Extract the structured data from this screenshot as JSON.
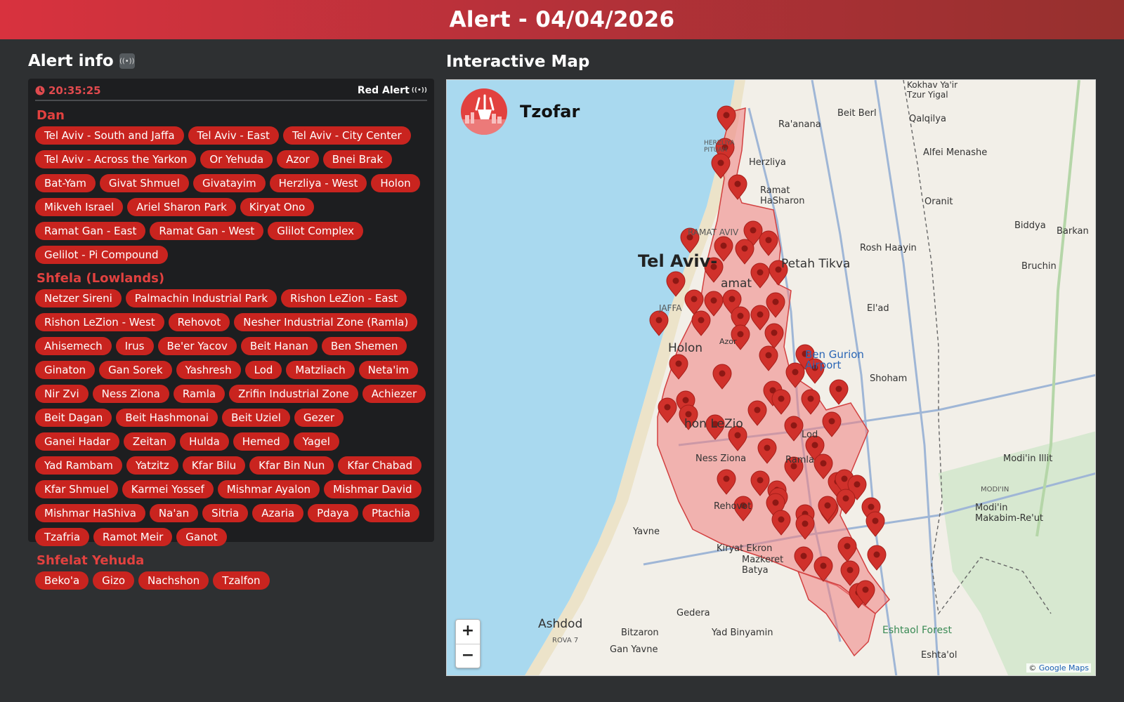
{
  "header": {
    "title": "Alert - 04/04/2026"
  },
  "alert_info": {
    "title": "Alert info",
    "time": "20:35:25",
    "alert_type": "Red Alert",
    "regions": [
      {
        "name": "Dan",
        "areas": [
          "Tel Aviv - South and Jaffa",
          "Tel Aviv - East",
          "Tel Aviv - City Center",
          "Tel Aviv - Across the Yarkon",
          "Or Yehuda",
          "Azor",
          "Bnei Brak",
          "Bat-Yam",
          "Givat Shmuel",
          "Givatayim",
          "Herzliya - West",
          "Holon",
          "Mikveh Israel",
          "Ariel Sharon Park",
          "Kiryat Ono",
          "Ramat Gan - East",
          "Ramat Gan - West",
          "Glilot Complex",
          "Gelilot - Pi Compound"
        ]
      },
      {
        "name": "Shfela (Lowlands)",
        "areas": [
          "Netzer Sireni",
          "Palmachin Industrial Park",
          "Rishon LeZion - East",
          "Rishon LeZion - West",
          "Rehovot",
          "Nesher Industrial Zone (Ramla)",
          "Ahisemech",
          "Irus",
          "Be'er Yacov",
          "Beit Hanan",
          "Ben Shemen",
          "Ginaton",
          "Gan Sorek",
          "Yashresh",
          "Lod",
          "Matzliach",
          "Neta'im",
          "Nir Zvi",
          "Ness Ziona",
          "Ramla",
          "Zrifin Industrial Zone",
          "Achiezer",
          "Beit Dagan",
          "Beit Hashmonai",
          "Beit Uziel",
          "Gezer",
          "Ganei Hadar",
          "Zeitan",
          "Hulda",
          "Hemed",
          "Yagel",
          "Yad Rambam",
          "Yatzitz",
          "Kfar Bilu",
          "Kfar Bin Nun",
          "Kfar Chabad",
          "Kfar Shmuel",
          "Karmei Yossef",
          "Mishmar Ayalon",
          "Mishmar David",
          "Mishmar HaShiva",
          "Na'an",
          "Sitria",
          "Azaria",
          "Pdaya",
          "Ptachia",
          "Tzafria",
          "Ramot Meir",
          "Ganot"
        ]
      },
      {
        "name": "Shfelat Yehuda",
        "areas": [
          "Beko'a",
          "Gizo",
          "Nachshon",
          "Tzalfon"
        ]
      }
    ]
  },
  "map": {
    "title": "Interactive Map",
    "brand": "Tzofar",
    "zoom_in": "+",
    "zoom_out": "−",
    "attribution_prefix": "© ",
    "attribution_link": "Google Maps",
    "labels": {
      "tel_aviv": "Tel Aviv-",
      "petah_tikva": "Petah Tikva",
      "holon": "Holon",
      "rishon": "hon LeZio",
      "ramat": "amat",
      "jaffa": "JAFFA",
      "ramat_aviv": "RAMAT AVIV",
      "herzliya": "Herzliya",
      "herzliya_pituah": "HERZLIYA PITUAH",
      "ramat_hasharon": "Ramat HaSharon",
      "raanana": "Ra'anana",
      "beit_berl": "Beit Berl",
      "qalqilya": "Qalqilya",
      "kokhav": "Kokhav Ya'ir Tzur Yigal",
      "alfei": "Alfei Menashe",
      "oranit": "Oranit",
      "biddya": "Biddya",
      "barkan": "Barkan",
      "rosh_haayin": "Rosh Haayin",
      "bruchin": "Bruchin",
      "elad": "El'ad",
      "ben_gurion": "Ben Gurion Airport",
      "shoham": "Shoham",
      "azor": "Azor",
      "lod": "Lod",
      "ramla": "Ramla",
      "ness_ziona": "Ness Ziona",
      "rehovot": "Rehovot",
      "yavne": "Yavne",
      "kiryat_ekron": "Kiryat Ekron",
      "mazkeret": "Mazkeret Batya",
      "modiin_illit": "Modi'in Illit",
      "modiin": "MODI'IN",
      "modiin_makabim": "Modi'in Makabim-Re'ut",
      "ashdod": "Ashdod",
      "rova7": "ROVA 7",
      "bitzaron": "Bitzaron",
      "gedera": "Gedera",
      "yad_binyamin": "Yad Binyamin",
      "gan_yavne": "Gan Yavne",
      "eshtaol": "Eshtaol Forest",
      "eshtaol2": "Eshta'ol"
    }
  },
  "colors": {
    "accent_red": "#c9241f",
    "region_red": "#e2413f",
    "water": "#a7d8ef",
    "header_gradient_start": "#d8323e",
    "header_gradient_end": "#96302e"
  }
}
